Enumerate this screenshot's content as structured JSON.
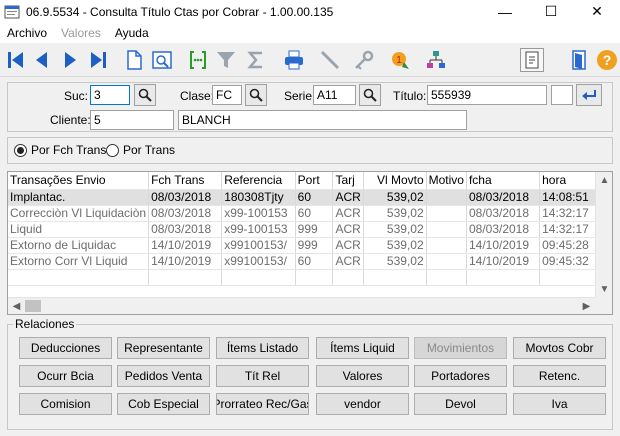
{
  "window": {
    "title": "06.9.5534 - Consulta Título Ctas por Cobrar - 1.00.00.135",
    "minimize": "—",
    "maximize": "☐",
    "close": "✕"
  },
  "menu": [
    {
      "label": "Archivo",
      "enabled": true
    },
    {
      "label": "Valores",
      "enabled": false
    },
    {
      "label": "Ayuda",
      "enabled": true
    }
  ],
  "toolbar": {
    "icons": [
      "first-icon",
      "previous-icon",
      "next-icon",
      "last-icon",
      "document-icon",
      "preview-icon",
      "bracket-icon",
      "filter-icon",
      "sigma-icon",
      "print-icon",
      "pen-icon",
      "key-icon",
      "alert-icon",
      "tree-icon",
      "page-icon",
      "exit-door-icon",
      "help-icon"
    ]
  },
  "filters": {
    "suc_label": "Suc:",
    "suc_value": "3",
    "clase_label": "Clase:",
    "clase_value": "FC",
    "serie_label": "Serie:",
    "serie_value": "A11",
    "titulo_label": "Título:",
    "titulo_value": "555939",
    "extra_value": "",
    "cliente_label": "Cliente:",
    "cliente_code": "5",
    "cliente_name": "BLANCH"
  },
  "order": {
    "option1": "Por Fch Trans",
    "option2": "Por Trans",
    "selected": "Por Fch Trans"
  },
  "grid": {
    "columns": [
      "Transações Envio",
      "Fch Trans",
      "Referencia",
      "Port",
      "Tarj",
      "Vl Movto",
      "Motivo",
      "fcha",
      "hora"
    ],
    "rows": [
      {
        "trans": "Implantac.",
        "fch": "08/03/2018",
        "ref": "180308Tjty",
        "port": "60",
        "tarj": "ACR",
        "vl": "539,02",
        "motivo": "",
        "fcha": "08/03/2018",
        "hora": "14:08:51"
      },
      {
        "trans": "Correcciòn Vl Liquidaciòn",
        "fch": "08/03/2018",
        "ref": "x99-100153",
        "port": "60",
        "tarj": "ACR",
        "vl": "539,02",
        "motivo": "",
        "fcha": "08/03/2018",
        "hora": "14:32:17"
      },
      {
        "trans": "Liquid",
        "fch": "08/03/2018",
        "ref": "x99-100153",
        "port": "999",
        "tarj": "ACR",
        "vl": "539,02",
        "motivo": "",
        "fcha": "08/03/2018",
        "hora": "14:32:17"
      },
      {
        "trans": "Extorno de Liquidac",
        "fch": "14/10/2019",
        "ref": "x99100153/",
        "port": "999",
        "tarj": "ACR",
        "vl": "539,02",
        "motivo": "",
        "fcha": "14/10/2019",
        "hora": "09:45:28"
      },
      {
        "trans": "Extorno Corr Vl Liquid",
        "fch": "14/10/2019",
        "ref": "x99100153/",
        "port": "60",
        "tarj": "ACR",
        "vl": "539,02",
        "motivo": "",
        "fcha": "14/10/2019",
        "hora": "09:45:32"
      }
    ]
  },
  "relaciones": {
    "legend": "Relaciones",
    "buttons": [
      {
        "label": "Deducciones",
        "enabled": true
      },
      {
        "label": "Representante",
        "enabled": true
      },
      {
        "label": "Ítems Listado",
        "enabled": true
      },
      {
        "label": "Ítems Liquid",
        "enabled": true
      },
      {
        "label": "Movimientos",
        "enabled": false
      },
      {
        "label": "Movtos Cobr",
        "enabled": true
      },
      {
        "label": "Ocurr Bcia",
        "enabled": true
      },
      {
        "label": "Pedidos Venta",
        "enabled": true
      },
      {
        "label": "Tít Rel",
        "enabled": true
      },
      {
        "label": "Valores",
        "enabled": true
      },
      {
        "label": "Portadores",
        "enabled": true
      },
      {
        "label": "Retenc.",
        "enabled": true
      },
      {
        "label": "Comision",
        "enabled": true
      },
      {
        "label": "Cob Especial",
        "enabled": true
      },
      {
        "label": "Prorrateo Rec/Gas",
        "enabled": true
      },
      {
        "label": "vendor",
        "enabled": true
      },
      {
        "label": "Devol",
        "enabled": true
      },
      {
        "label": "Iva",
        "enabled": true
      }
    ]
  },
  "colors": {
    "nav_blue": "#1f5fc4",
    "focus_blue": "#0078d7",
    "help_orange": "#f0a020"
  }
}
